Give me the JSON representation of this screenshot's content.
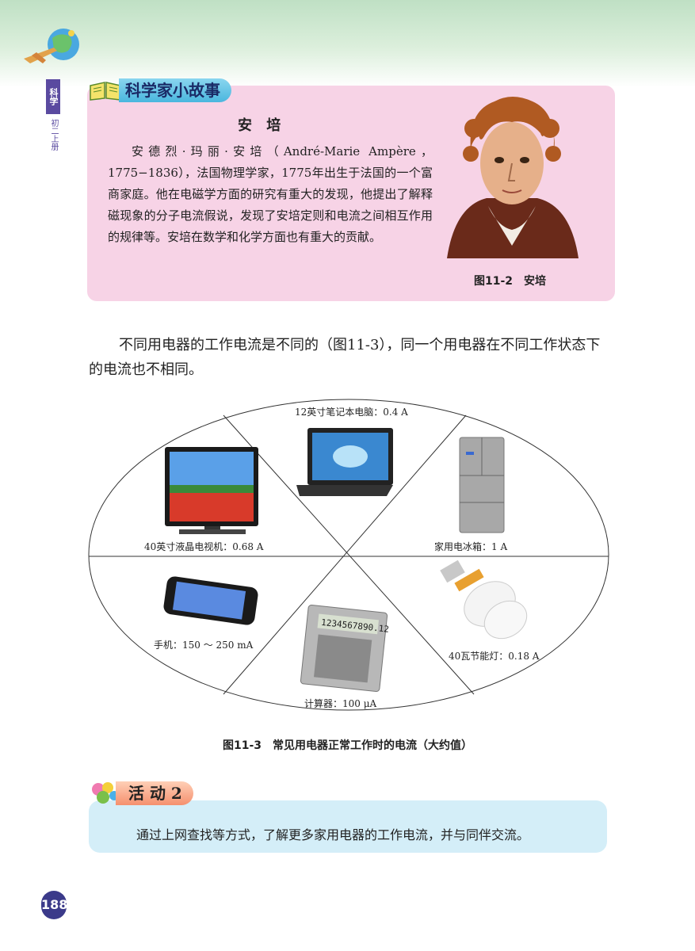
{
  "side_tab": {
    "subject": "科学",
    "grade": "初二上册"
  },
  "story": {
    "header": "科学家小故事",
    "name": "安 培",
    "body": "安德烈·玛丽·安培（André-Marie Ampère，1775−1836），法国物理学家，1775年出生于法国的一个富商家庭。他在电磁学方面的研究有重大的发现，他提出了解释磁现象的分子电流假说，发现了安培定则和电流之间相互作用的规律等。安培在数学和化学方面也有重大的贡献。",
    "figure_caption": "图11-2　安培"
  },
  "main_paragraph": "不同用电器的工作电流是不同的（图11-3），同一个用电器在不同工作状态下的电流也不相同。",
  "diagram": {
    "laptop": "12英寸笔记本电脑：0.4 A",
    "tv": "40英寸液晶电视机：0.68 A",
    "fridge": "家用电冰箱：1 A",
    "phone": "手机：150 ～ 250 mA",
    "lamp": "40瓦节能灯：0.18 A",
    "calculator": "计算器：100 μA",
    "calculator_display": "1234567890.12"
  },
  "figure_caption": "图11-3　常见用电器正常工作时的电流（大约值）",
  "activity": {
    "header": "活 动 2",
    "text": "通过上网查找等方式，了解更多家用电器的工作电流，并与同伴交流。"
  },
  "page_number": "188"
}
